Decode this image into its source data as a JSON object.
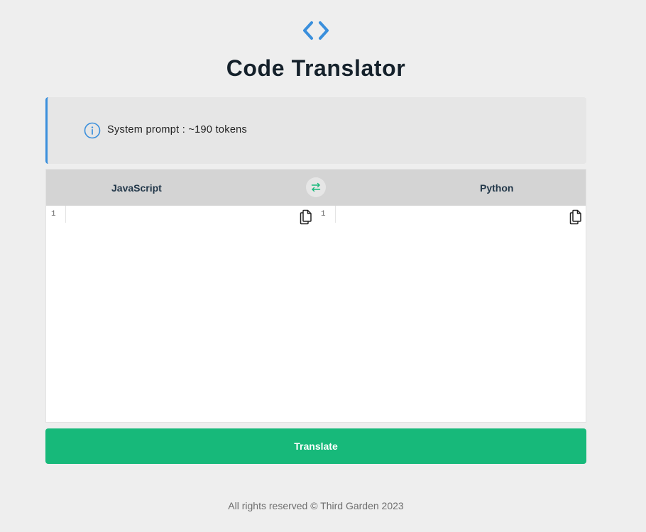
{
  "header": {
    "logo_icon": "code-brackets-icon",
    "title": "Code Translator"
  },
  "info": {
    "icon": "info-circle-icon",
    "text": "System prompt : ~190 tokens"
  },
  "editor": {
    "source_language": "JavaScript",
    "target_language": "Python",
    "swap_icon": "swap-arrows-icon",
    "copy_icon": "copy-icon",
    "source_line_number": "1",
    "target_line_number": "1",
    "source_code": "",
    "target_code": ""
  },
  "actions": {
    "translate_label": "Translate"
  },
  "footer": {
    "text": "All rights reserved © Third Garden 2023"
  },
  "colors": {
    "background": "#eeeeee",
    "accent_blue": "#3a8fdc",
    "accent_green": "#17b97a",
    "title": "#15212b"
  }
}
